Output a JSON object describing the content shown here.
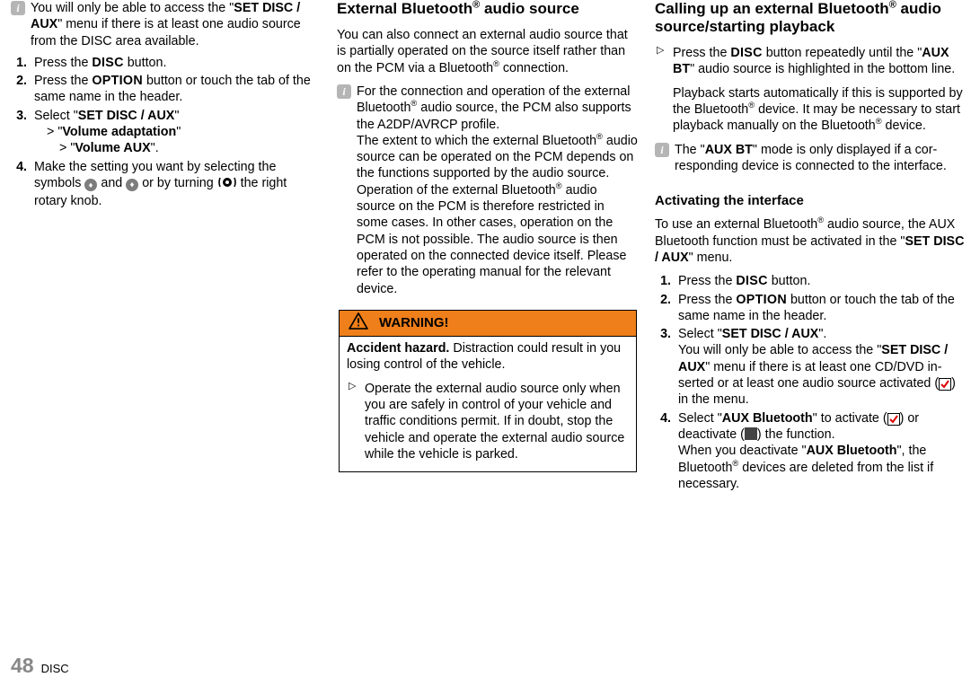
{
  "footer": {
    "page": "48",
    "section": "DISC"
  },
  "col1": {
    "info": {
      "pre": "You will only be able to access the \"",
      "b1": "SET DISC / AUX",
      "post": "\" menu if there is at least one audio source from the DISC area available."
    },
    "s1": {
      "a": "Press the ",
      "btn": "DISC",
      "b": " button."
    },
    "s2": {
      "a": "Press the ",
      "btn": "OPTION",
      "b": " button or touch the tab of the same name in the header."
    },
    "s3": {
      "a": "Select \"",
      "b1": "SET DISC / AUX",
      "b": "\"",
      "l2a": "\"",
      "l2b": "Volume adaptation",
      "l2c": "\"",
      "l3a": "\"",
      "l3b": "Volume AUX",
      "l3c": "\"."
    },
    "s4": {
      "a": "Make the setting you want by selecting the symbols ",
      "b": " and ",
      "c": " or by turning ",
      "d": " the right rotary knob."
    }
  },
  "col2": {
    "h": "External Bluetooth",
    "hreg": "®",
    "hpost": " audio source",
    "p1a": "You can also connect an external audio source that is partially operated on the source itself rath­er than on the PCM via a Bluetooth",
    "p1b": " connection.",
    "info1a": "For the connection and operation of the exter­nal Bluetooth",
    "info1b": " audio source, the PCM also supports the A2DP/AVRCP profile.",
    "info1c": "The extent to which the external Bluetooth",
    "info1d": " audio source can be operated on the PCM de­pends on the functions supported by the au­dio source. Operation of the external Blue­tooth",
    "info1e": " audio source on the PCM is therefore restricted in some cases. In other cases, op­eration on the PCM is not possible. The audio source is then operated on the connected de­vice itself. Please refer to the operating man­ual for the relevant device.",
    "warnLabel": "WARNING!",
    "warnBody1": "Accident hazard.",
    "warnBody2": " Distraction could result in you losing control of the vehicle.",
    "warnLi": "Operate the external audio source only when you are safely in control of your vehi­cle and traffic conditions permit. If in doubt, stop the vehicle and operate the external audio source while the vehicle is parked."
  },
  "col3": {
    "h1a": "Calling up an external Bluetooth",
    "h1b": " audio source/starting playback",
    "li1a": "Press the ",
    "li1btn": "DISC",
    "li1b": " button repeatedly until the \"",
    "li1bold": "AUX BT",
    "li1c": "\" audio source is highlighted in the bot­tom line.",
    "li1p2a": "Playback starts automatically if this is support­ed by the Bluetooth",
    "li1p2b": " device. It may be neces­sary to start playback manually on the Blue­tooth",
    "li1p2c": " device.",
    "info2a": "The \"",
    "info2b": "AUX BT",
    "info2c": "\" mode is only displayed if a cor­responding device is connected to the inter­face.",
    "h2": "Activating the interface",
    "p3a": "To use an external Bluetooth",
    "p3b": " audio source, the AUX Bluetooth function must be activated in the \"",
    "p3bold": "SET DISC / AUX",
    "p3c": "\" menu.",
    "s1": {
      "a": "Press the ",
      "btn": "DISC",
      "b": " button."
    },
    "s2": {
      "a": "Press the ",
      "btn": "OPTION",
      "b": " button or touch the tab of the same name in the header."
    },
    "s3a": "Select \"",
    "s3b": "SET DISC / AUX",
    "s3c": "\".",
    "s3d": "You will only be able to access the \"",
    "s3e": "SET DISC / AUX",
    "s3f": "\" menu if there is at least one CD/DVD in­serted or at least one audio source activated (",
    "s3g": ") in the menu.",
    "s4a": "Select \"",
    "s4b": "AUX Bluetooth",
    "s4c": "\" to activate (",
    "s4d": ") or deactivate (",
    "s4e": ") the function.",
    "s4f": "When you deactivate \"",
    "s4g": "AUX Bluetooth",
    "s4h": "\", the Bluetooth",
    "s4i": " devices are deleted from the list if necessary."
  }
}
